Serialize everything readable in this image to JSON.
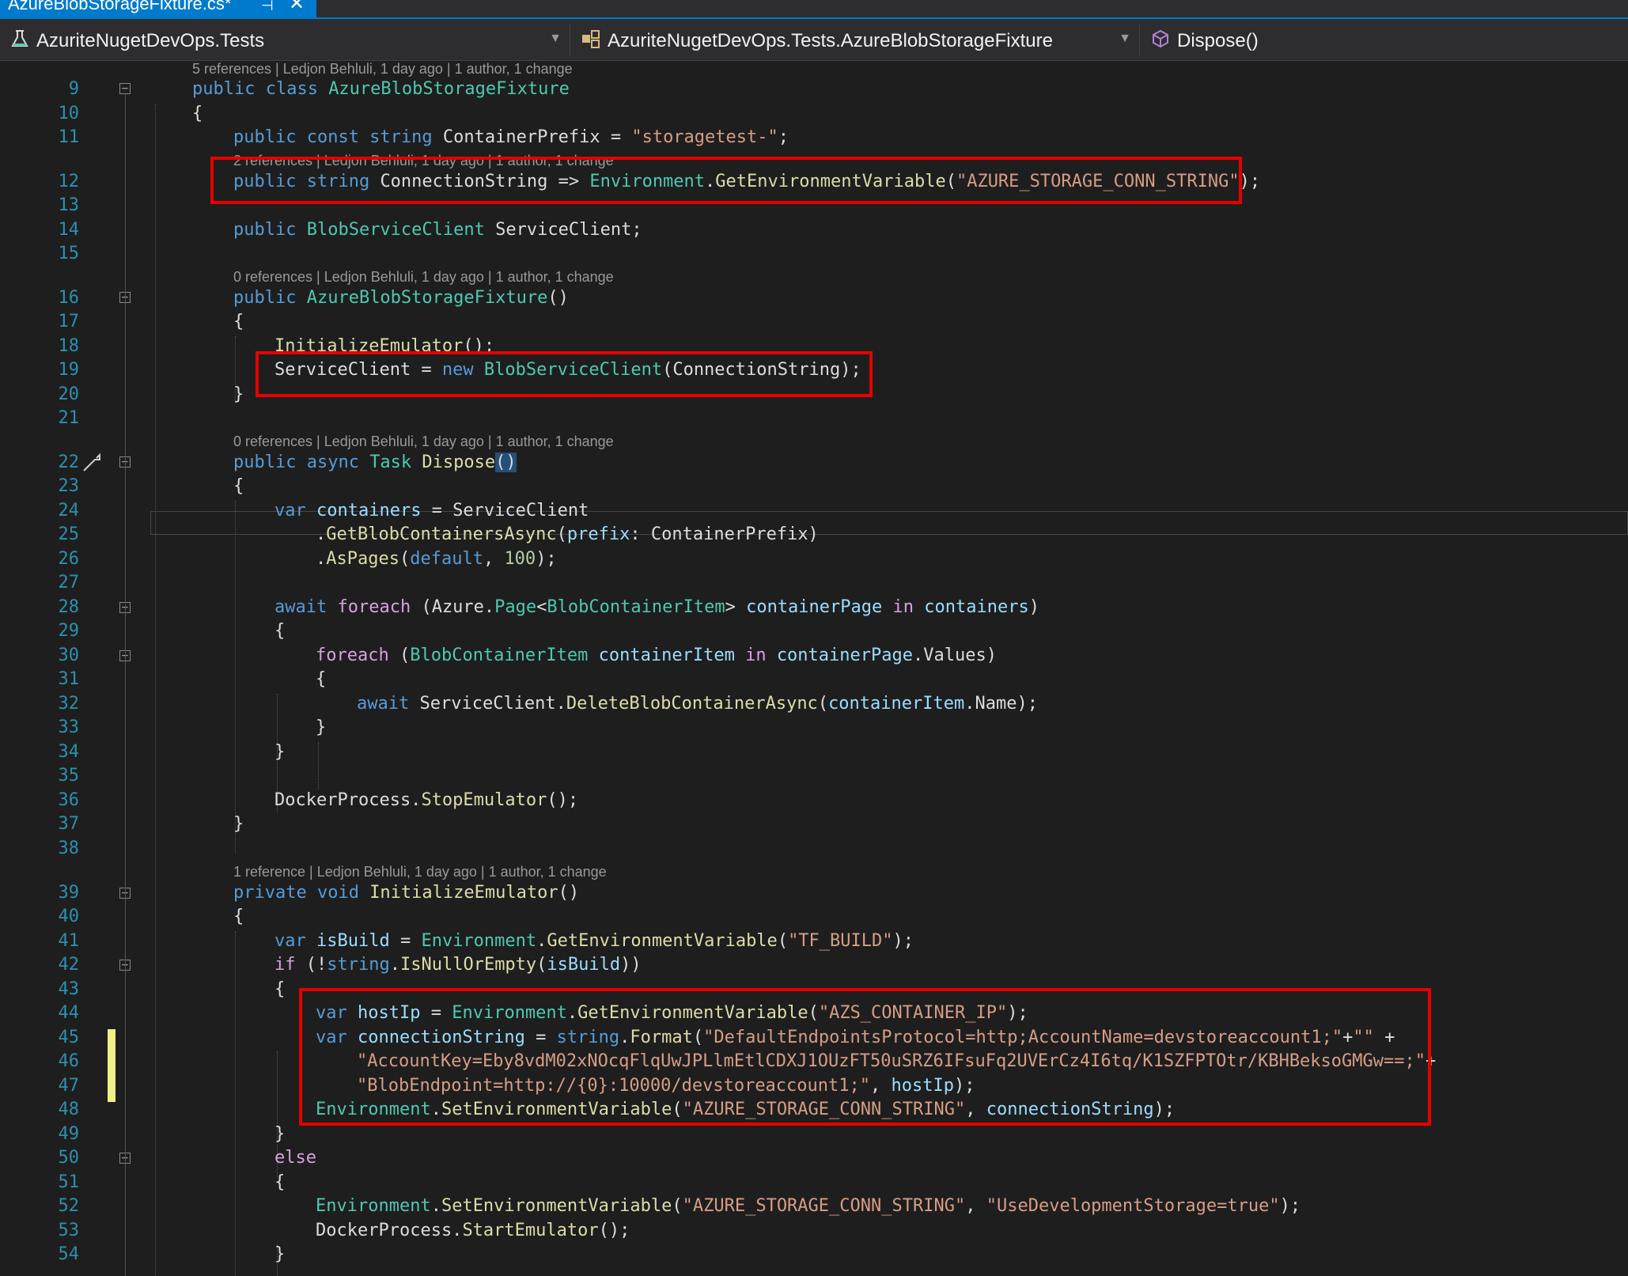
{
  "tab": {
    "title": "AzureBlobStorageFixture.cs*",
    "pin_icon": "pin-icon",
    "close_icon": "close-icon"
  },
  "navbar": {
    "project": "AzuriteNugetDevOps.Tests",
    "type": "AzuriteNugetDevOps.Tests.AzureBlobStorageFixture",
    "member": "Dispose()"
  },
  "lenses": {
    "l9": "5 references | Ledjon Behluli, 1 day ago | 1 author, 1 change",
    "l12": "2 references | Ledjon Behluli, 1 day ago | 1 author, 1 change",
    "l16": "0 references | Ledjon Behluli, 1 day ago | 1 author, 1 change",
    "l22": "0 references | Ledjon Behluli, 1 day ago | 1 author, 1 change",
    "l39": "1 reference | Ledjon Behluli, 1 day ago | 1 author, 1 change"
  },
  "line_numbers": [
    "9",
    "10",
    "11",
    "12",
    "13",
    "14",
    "15",
    "16",
    "17",
    "18",
    "19",
    "20",
    "21",
    "22",
    "23",
    "24",
    "25",
    "26",
    "27",
    "28",
    "29",
    "30",
    "31",
    "32",
    "33",
    "34",
    "35",
    "36",
    "37",
    "38",
    "39",
    "40",
    "41",
    "42",
    "43",
    "44",
    "45",
    "46",
    "47",
    "48",
    "49",
    "50",
    "51",
    "52",
    "53",
    "54"
  ],
  "code": {
    "l9_a": "public class ",
    "l9_b": "AzureBlobStorageFixture",
    "l10": "{",
    "l11_a": "public const string ",
    "l11_b": "ContainerPrefix = ",
    "l11_c": "\"storagetest-\"",
    "l11_d": ";",
    "l12_a": "public string ",
    "l12_b": "ConnectionString => ",
    "l12_c": "Environment",
    "l12_d": ".",
    "l12_e": "GetEnvironmentVariable",
    "l12_f": "(",
    "l12_g": "\"AZURE_STORAGE_CONN_STRING\"",
    "l12_h": ");",
    "l14_a": "public ",
    "l14_b": "BlobServiceClient",
    "l14_c": " ServiceClient;",
    "l16_a": "public ",
    "l16_b": "AzureBlobStorageFixture",
    "l16_c": "()",
    "l17": "{",
    "l18_a": "InitializeEmulator",
    "l18_b": "();",
    "l19_a": "ServiceClient = ",
    "l19_b": "new ",
    "l19_c": "BlobServiceClient",
    "l19_d": "(ConnectionString);",
    "l20": "}",
    "l22_a": "public async ",
    "l22_b": "Task ",
    "l22_c": "Dispose",
    "l22_d": "()",
    "l23": "{",
    "l24_a": "var ",
    "l24_b": "containers",
    "l24_c": " = ServiceClient",
    "l25_a": ".",
    "l25_b": "GetBlobContainersAsync",
    "l25_c": "(",
    "l25_d": "prefix",
    "l25_e": ": ContainerPrefix)",
    "l26_a": ".",
    "l26_b": "AsPages",
    "l26_c": "(",
    "l26_d": "default",
    "l26_e": ", ",
    "l26_f": "100",
    "l26_g": ");",
    "l28_a": "await ",
    "l28_b": "foreach",
    "l28_c": " (Azure.",
    "l28_d": "Page",
    "l28_e": "<",
    "l28_f": "BlobContainerItem",
    "l28_g": "> ",
    "l28_h": "containerPage",
    "l28_i": " in ",
    "l28_j": "containers",
    "l28_k": ")",
    "l29": "{",
    "l30_a": "foreach",
    "l30_b": " (",
    "l30_c": "BlobContainerItem",
    "l30_d": " ",
    "l30_e": "containerItem",
    "l30_f": " in ",
    "l30_g": "containerPage",
    "l30_h": ".Values)",
    "l31": "{",
    "l32_a": "await ",
    "l32_b": "ServiceClient.",
    "l32_c": "DeleteBlobContainerAsync",
    "l32_d": "(",
    "l32_e": "containerItem",
    "l32_f": ".Name);",
    "l33": "}",
    "l34": "}",
    "l36_a": "DockerProcess.",
    "l36_b": "StopEmulator",
    "l36_c": "();",
    "l37": "}",
    "l39_a": "private void ",
    "l39_b": "InitializeEmulator",
    "l39_c": "()",
    "l40": "{",
    "l41_a": "var ",
    "l41_b": "isBuild",
    "l41_c": " = ",
    "l41_d": "Environment",
    "l41_e": ".",
    "l41_f": "GetEnvironmentVariable",
    "l41_g": "(",
    "l41_h": "\"TF_BUILD\"",
    "l41_i": ");",
    "l42_a": "if",
    "l42_b": " (!",
    "l42_c": "string",
    "l42_d": ".",
    "l42_e": "IsNullOrEmpty",
    "l42_f": "(",
    "l42_g": "isBuild",
    "l42_h": "))",
    "l43": "{",
    "l44_a": "var ",
    "l44_b": "hostIp",
    "l44_c": " = ",
    "l44_d": "Environment",
    "l44_e": ".",
    "l44_f": "GetEnvironmentVariable",
    "l44_g": "(",
    "l44_h": "\"AZS_CONTAINER_IP\"",
    "l44_i": ");",
    "l45_a": "var ",
    "l45_b": "connectionString",
    "l45_c": " = ",
    "l45_d": "string",
    "l45_e": ".",
    "l45_f": "Format",
    "l45_g": "(",
    "l45_h": "\"DefaultEndpointsProtocol=http;AccountName=devstoreaccount1;\"",
    "l45_i": "+",
    "l45_j": "\"\"",
    "l45_k": " +",
    "l46_a": "\"AccountKey=Eby8vdM02xNOcqFlqUwJPLlmEtlCDXJ1OUzFT50uSRZ6IFsuFq2UVErCz4I6tq/K1SZFPTOtr/KBHBeksoGMGw==;\"",
    "l46_b": "+",
    "l47_a": "\"BlobEndpoint=http://{0}:10000/devstoreaccount1;\"",
    "l47_b": ", ",
    "l47_c": "hostIp",
    "l47_d": ");",
    "l48_a": "Environment",
    "l48_b": ".",
    "l48_c": "SetEnvironmentVariable",
    "l48_d": "(",
    "l48_e": "\"AZURE_STORAGE_CONN_STRING\"",
    "l48_f": ", ",
    "l48_g": "connectionString",
    "l48_h": ");",
    "l49": "}",
    "l50": "else",
    "l51": "{",
    "l52_a": "Environment",
    "l52_b": ".",
    "l52_c": "SetEnvironmentVariable",
    "l52_d": "(",
    "l52_e": "\"AZURE_STORAGE_CONN_STRING\"",
    "l52_f": ", ",
    "l52_g": "\"UseDevelopmentStorage=true\"",
    "l52_h": ");",
    "l53_a": "DockerProcess.",
    "l53_b": "StartEmulator",
    "l53_c": "();",
    "l54": "}"
  },
  "colors": {
    "highlight_box": "#e60000",
    "accent": "#007acc"
  }
}
